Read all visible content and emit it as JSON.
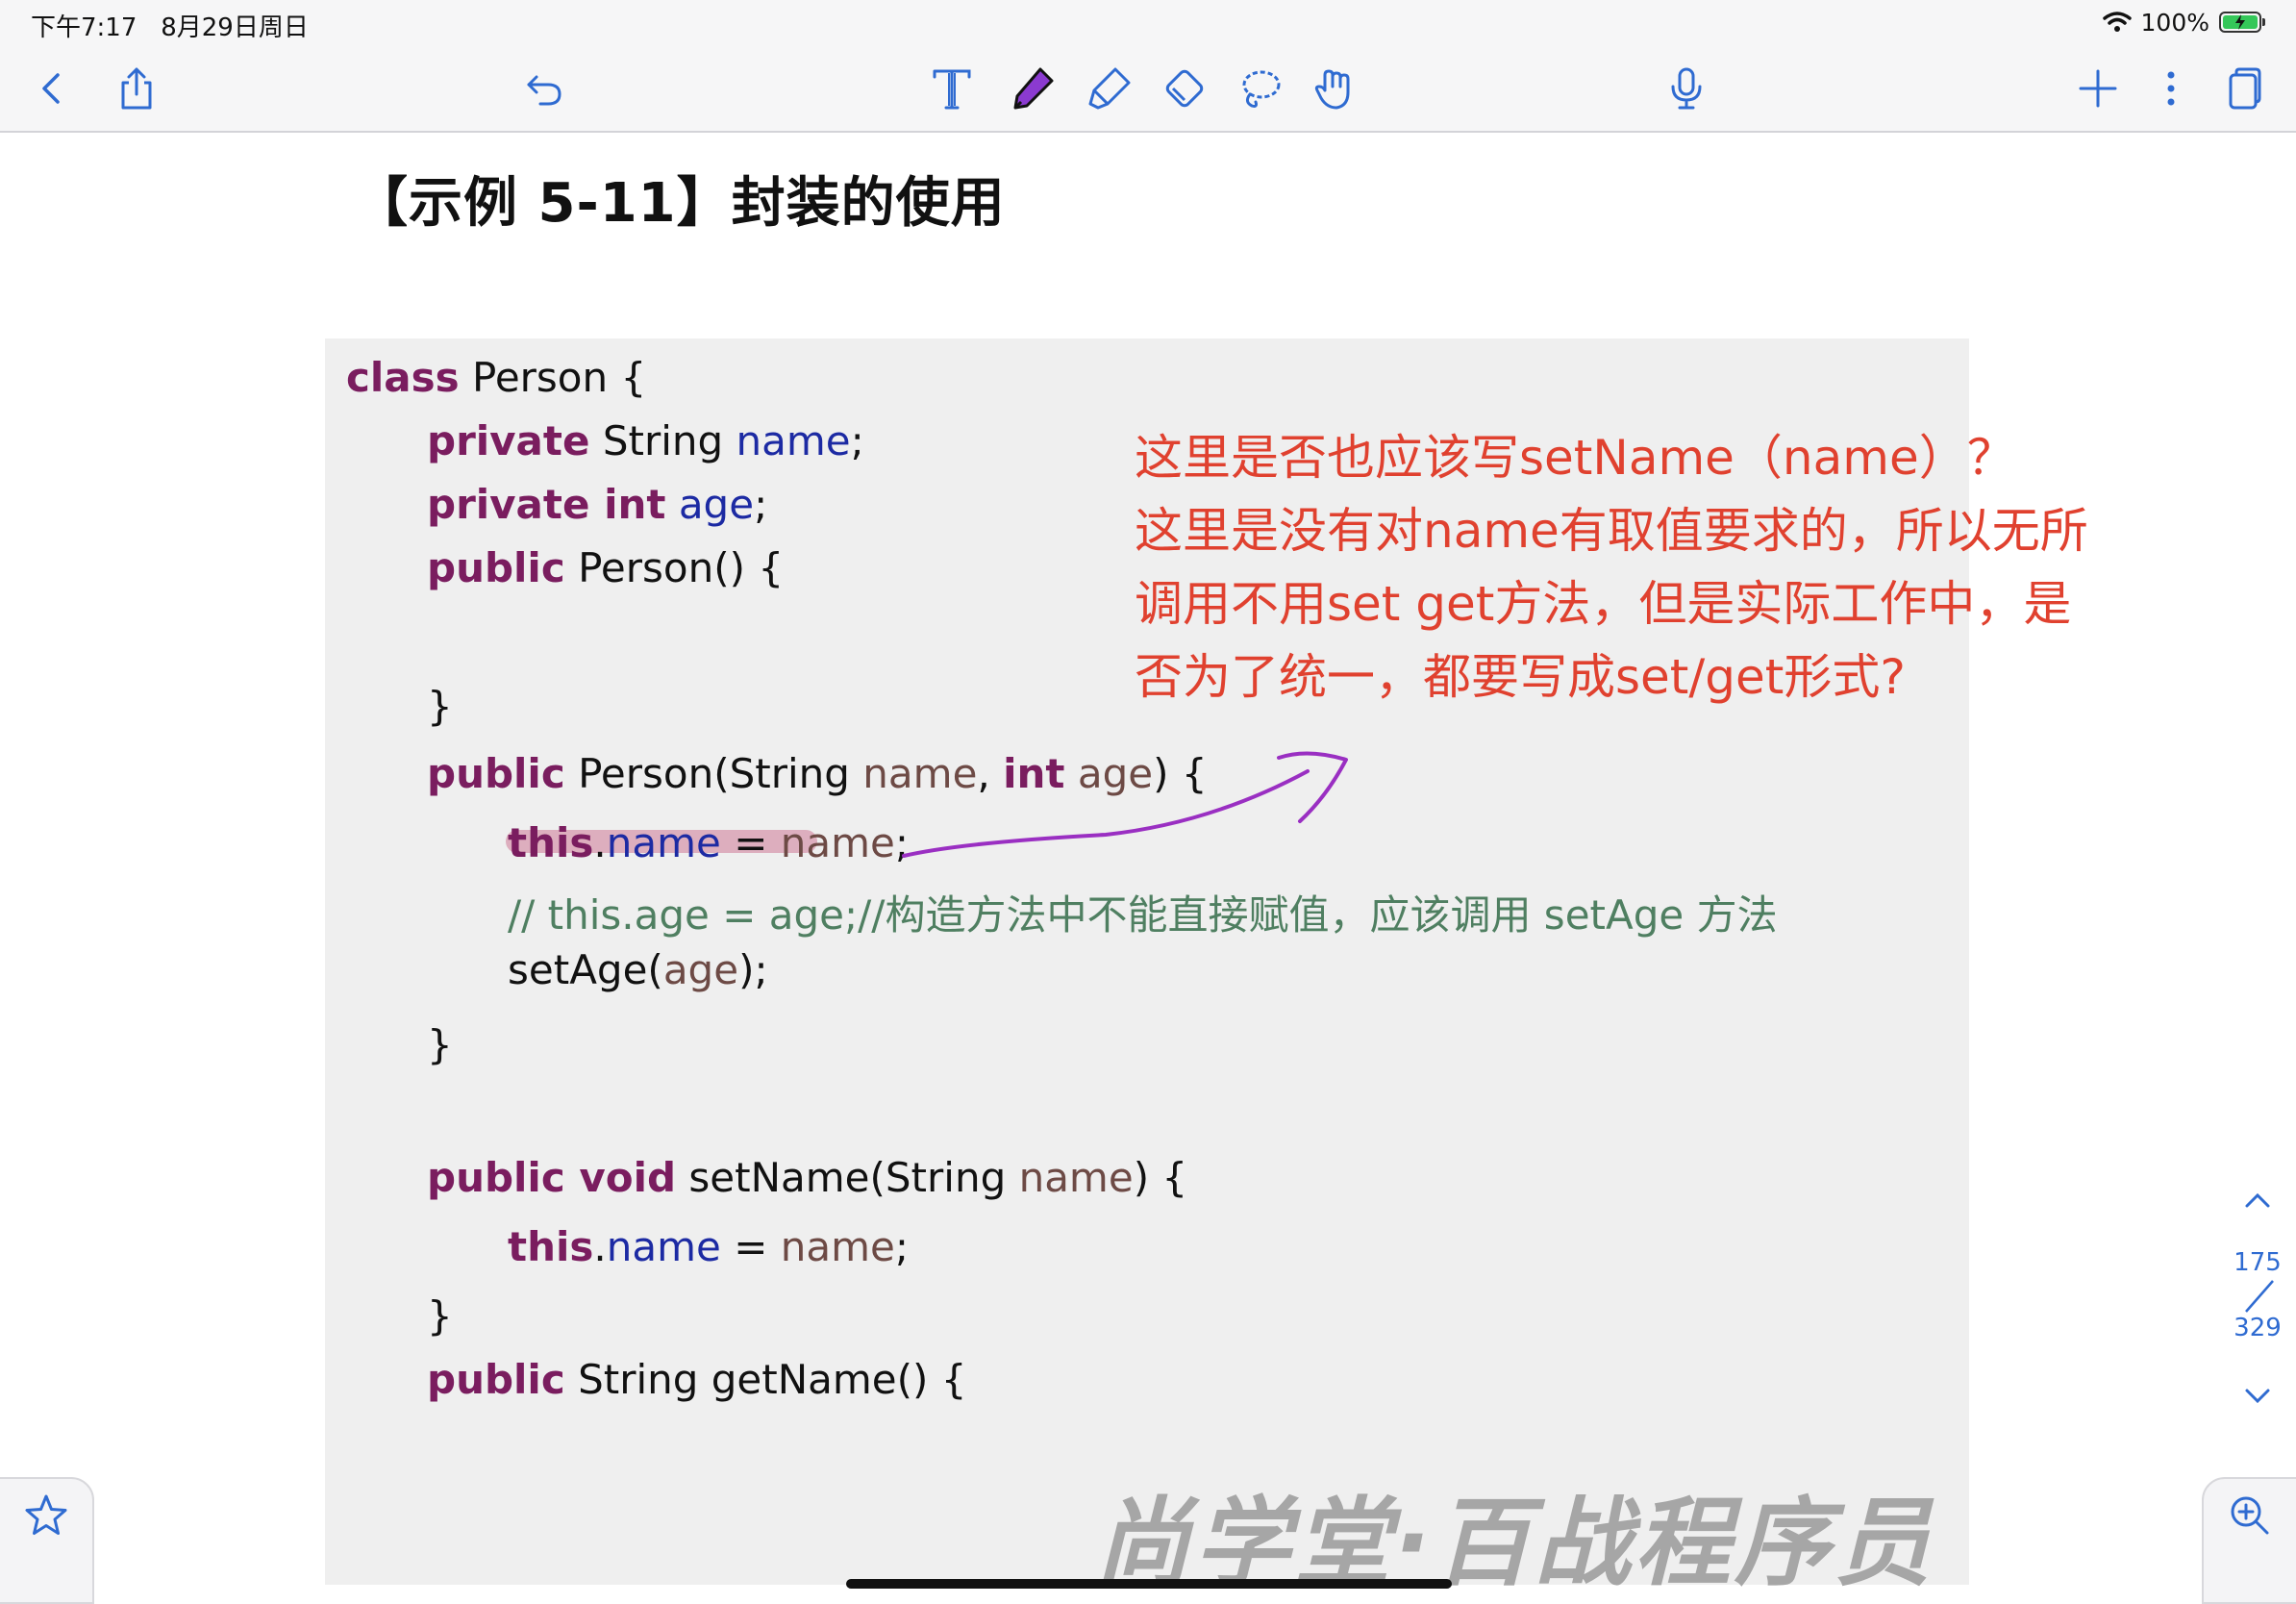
{
  "status": {
    "time": "下午7:17",
    "date": "8月29日周日",
    "battery": "100%"
  },
  "toolbar": {
    "left": [
      "back-icon",
      "share-icon"
    ],
    "undo": "undo-icon",
    "tools": [
      "text-tool-icon",
      "pen-tool-icon",
      "highlighter-tool-icon",
      "eraser-tool-icon",
      "lasso-tool-icon",
      "hand-select-icon"
    ],
    "mic": "microphone-icon",
    "right": [
      "add-icon",
      "more-icon",
      "pages-icon"
    ],
    "accent": "#2f6bd1"
  },
  "doc": {
    "title": "【示例 5-11】封装的使用",
    "code": {
      "l1_kw": "class",
      "l1_rest": " Person {",
      "l2_kw": "private",
      "l2_type": " String ",
      "l2_fld": "name",
      "l2_end": ";",
      "l3_kw": "private int",
      "l3_sp": " ",
      "l3_fld": "age",
      "l3_end": ";",
      "l4_kw": "public",
      "l4_rest": " Person() {",
      "l5": "}",
      "l6_kw": "public",
      "l6_a": " Person(String ",
      "l6_v1": "name",
      "l6_b": ", ",
      "l6_kw2": "int",
      "l6_sp": " ",
      "l6_v2": "age",
      "l6_c": ") {",
      "l7_kw": "this",
      "l7_dot": ".",
      "l7_fld": "name",
      "l7_eq": " = ",
      "l7_var": "name",
      "l7_end": ";",
      "l8_comment": "// this.age = age;//构造方法中不能直接赋值，应该调用 setAge 方法",
      "l9_a": "setAge(",
      "l9_var": "age",
      "l9_b": ");",
      "l10": "}",
      "l11_kw": "public void",
      "l11_a": " setName(String ",
      "l11_var": "name",
      "l11_b": ") {",
      "l12_kw": "this",
      "l12_dot": ".",
      "l12_fld": "name",
      "l12_eq": " = ",
      "l12_var": "name",
      "l12_end": ";",
      "l13": "}",
      "l14_kw": "public",
      "l14_rest": " String getName() {"
    },
    "annotation": "这里是否也应该写setName（name）？\n这里是没有对name有取值要求的，所以无所\n调用不用set get方法，但是实际工作中，是\n否为了统一，都要写成set/get形式?",
    "annotation_color": "#e0412f",
    "watermark": "尚学堂·百战程序员"
  },
  "pager": {
    "current": "175",
    "total": "329"
  },
  "corners": {
    "left": "star-icon",
    "right": "zoom-in-icon"
  }
}
